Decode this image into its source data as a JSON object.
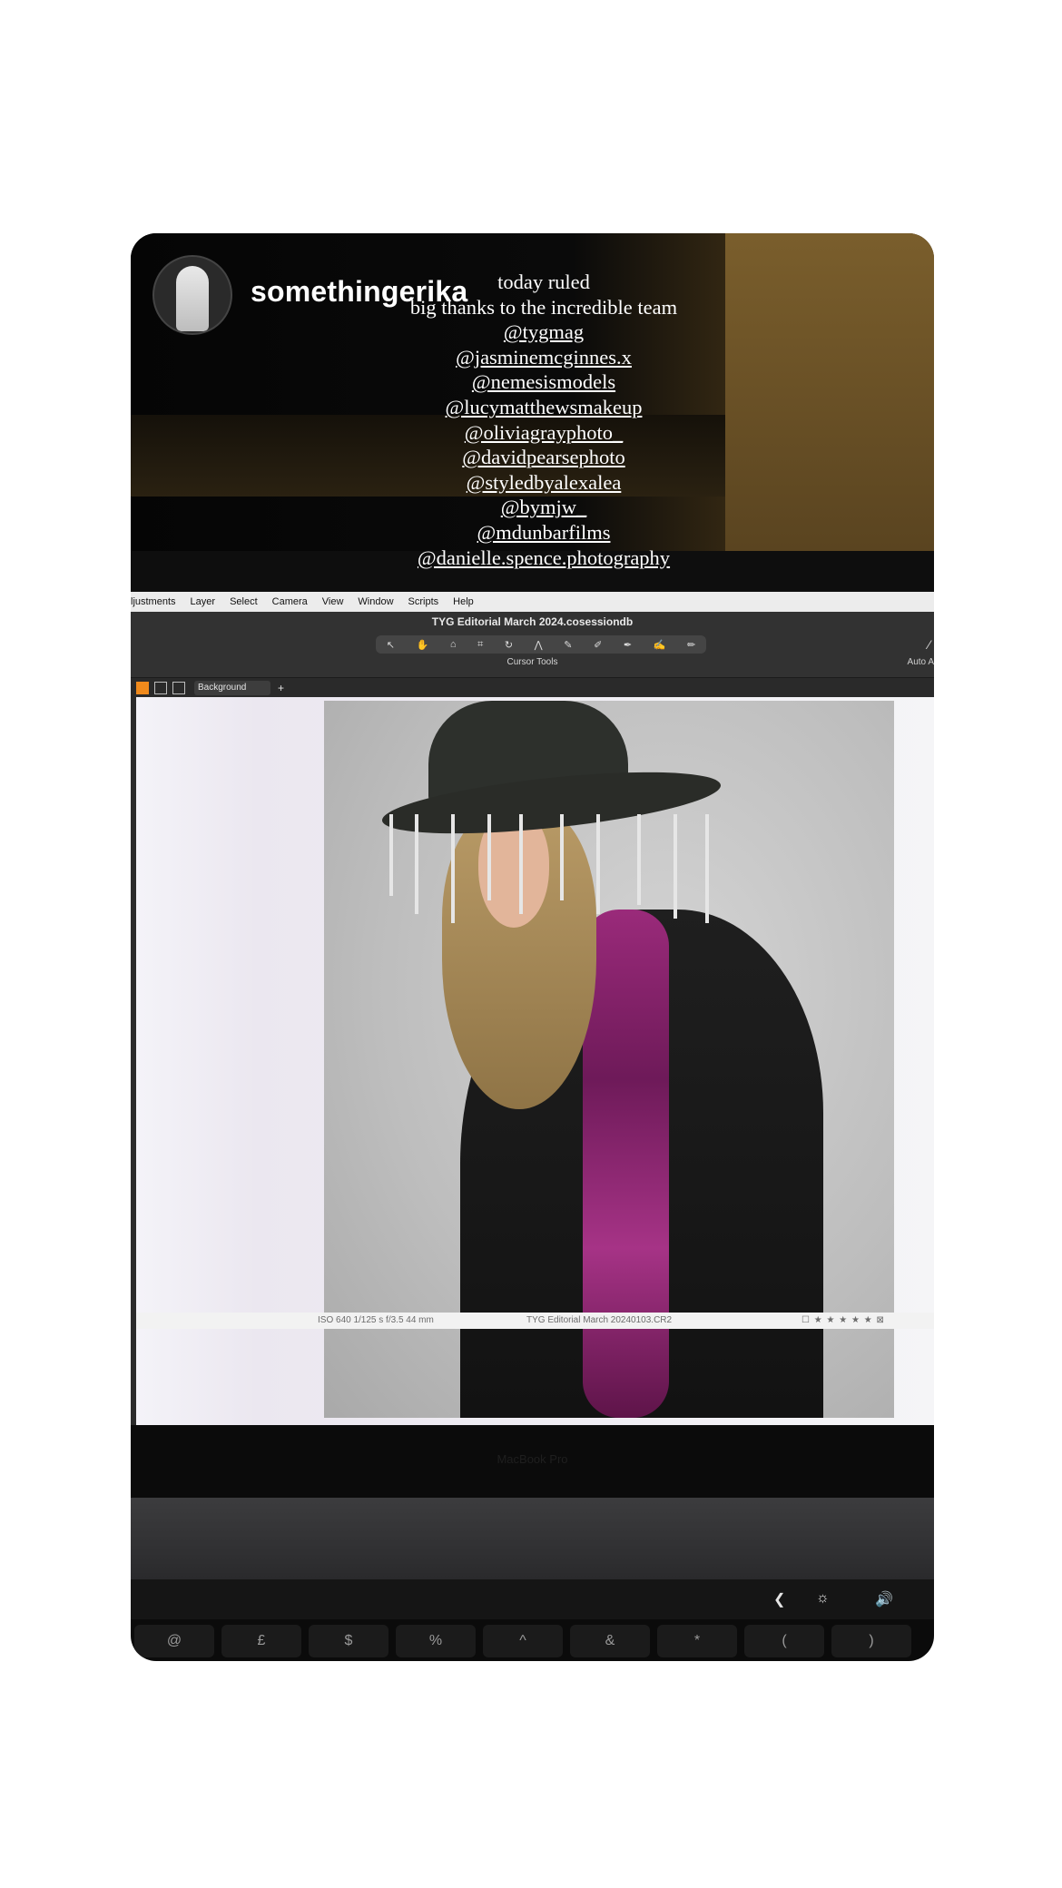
{
  "story": {
    "username": "somethingerika",
    "caption_lines": [
      "today ruled",
      "big thanks to the incredible team"
    ],
    "tags": [
      "@tygmag",
      "@jasminemcginnes.x",
      "@nemesismodels",
      "@lucymatthewsmakeup",
      "@oliviagrayphoto_",
      "@davidpearsephoto",
      "@styledbyalexalea",
      "@bymjw_",
      "@mdunbarfilms",
      "@danielle.spence.photography"
    ]
  },
  "app": {
    "menu": [
      "ljustments",
      "Layer",
      "Select",
      "Camera",
      "View",
      "Window",
      "Scripts",
      "Help"
    ],
    "window_title": "TYG Editorial March 2024.cosessiondb",
    "tool_caption": "Cursor Tools",
    "auto_label": "Auto A",
    "layer_select": "Background",
    "status": {
      "exif": "ISO 640   1/125 s   f/3.5   44 mm",
      "filename": "TYG Editorial March 20240103.CR2",
      "rating": "☐ ★ ★ ★ ★ ★ ⊠"
    }
  },
  "laptop": {
    "bezel_label": "MacBook Pro",
    "touchbar_icons": [
      "chevron-left-icon",
      "brightness-icon",
      "volume-icon"
    ],
    "keys": [
      "@",
      "£",
      "$",
      "%",
      "^",
      "&",
      "*",
      "(",
      ")"
    ]
  }
}
